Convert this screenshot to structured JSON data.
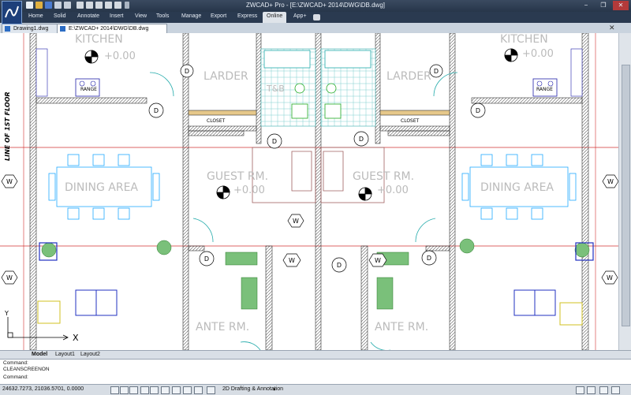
{
  "window": {
    "title": "ZWCAD+ Pro - [E:\\ZWCAD+ 2014\\DWG\\DB.dwg]",
    "minimize": "−",
    "restore": "❐",
    "close": "✕"
  },
  "menu": {
    "items": [
      "Home",
      "Solid",
      "Annotate",
      "Insert",
      "View",
      "Tools",
      "Manage",
      "Export",
      "Express",
      "Online",
      "App+"
    ],
    "active": "Online"
  },
  "tabs": [
    {
      "label": "Drawing1.dwg",
      "active": false
    },
    {
      "label": "E:\\ZWCAD+ 2014\\DWG\\DB.dwg",
      "active": true
    }
  ],
  "drawing": {
    "rooms": {
      "kitchen_left": "KITCHEN",
      "kitchen_right": "KITCHEN",
      "larder_left": "LARDER",
      "larder_right": "LARDER",
      "closet_left": "CLOSET",
      "closet_right": "CLOSET",
      "guest_left": "GUEST RM.",
      "guest_right": "GUEST RM.",
      "dining_left": "DINING AREA",
      "dining_right": "DINING AREA",
      "ante_left": "ANTE RM.",
      "ante_right": "ANTE RM.",
      "tb": "T&B"
    },
    "levels": {
      "kitchen_left": "+0.00",
      "kitchen_right": "+0.00",
      "guest_left": "+0.00",
      "guest_right": "+0.00"
    },
    "range_label": "RANGE",
    "floor_line_label": "LINE OF 1ST FLOOR",
    "door_tag": "D",
    "window_tag": "W",
    "axis_x": "X",
    "axis_y": "Y"
  },
  "layout_tabs": [
    "Model",
    "Layout1",
    "Layout2"
  ],
  "command": {
    "lines": [
      "Command:",
      "CLEANSCREENON",
      "Command:"
    ]
  },
  "status": {
    "coordinates": "24632.7273, 21036.5701, 0.0000",
    "workspace": "2D Drafting & Annotation"
  }
}
